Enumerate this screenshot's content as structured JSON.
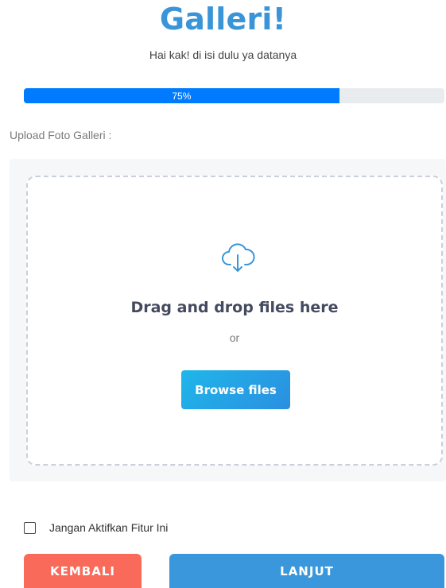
{
  "header": {
    "title": "Galleri!",
    "subtitle": "Hai kak! di isi dulu ya datanya"
  },
  "progress": {
    "value_percent": 75,
    "label": "75%",
    "fill_color": "#007bff",
    "track_color": "#e9ecef"
  },
  "upload": {
    "label": "Upload Foto Galleri :",
    "dropzone": {
      "icon": "cloud-download-icon",
      "title": "Drag and drop files here",
      "or_text": "or",
      "browse_label": "Browse files"
    }
  },
  "option": {
    "checkbox_label": "Jangan Aktifkan Fitur Ini",
    "checked": false
  },
  "actions": {
    "back_label": "KEMBALI",
    "next_label": "LANJUT",
    "back_color": "#fa6a5b",
    "next_color": "#3a97db"
  },
  "colors": {
    "accent": "#3a95d8"
  }
}
